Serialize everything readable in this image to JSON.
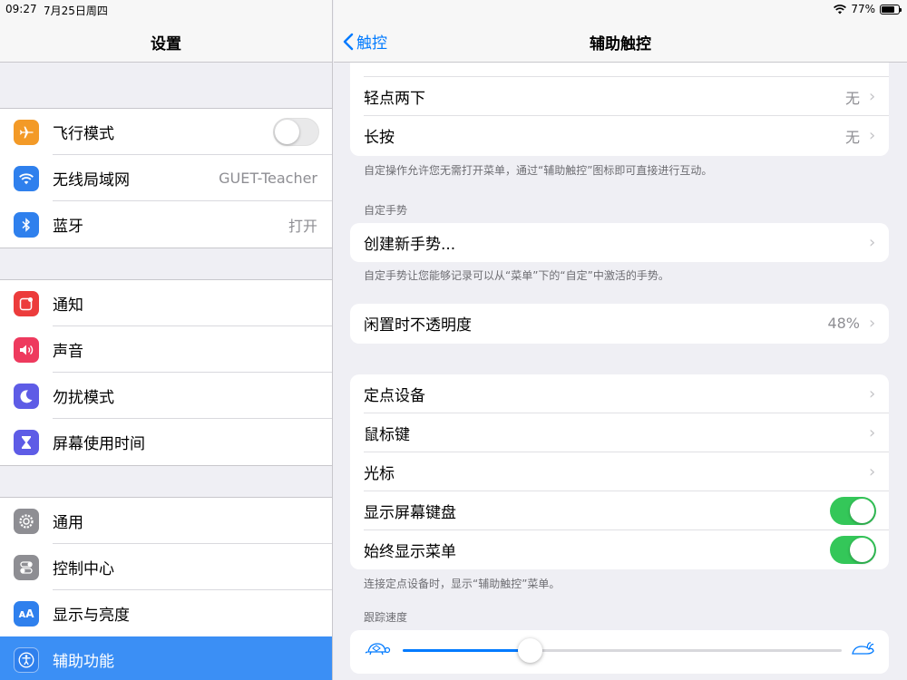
{
  "status": {
    "time": "09:27",
    "date": "7月25日周四",
    "battery": "77%"
  },
  "sidebar": {
    "title": "设置",
    "groups": [
      [
        {
          "label": "飞行模式",
          "icon": "airplane-icon",
          "color": "#f39a27",
          "toggle": "off"
        },
        {
          "label": "无线局域网",
          "icon": "wifi-icon",
          "color": "#2f80ed",
          "value": "GUET-Teacher"
        },
        {
          "label": "蓝牙",
          "icon": "bluetooth-icon",
          "color": "#2f80ed",
          "value": "打开"
        }
      ],
      [
        {
          "label": "通知",
          "icon": "notifications-icon",
          "color": "#ec3c3c"
        },
        {
          "label": "声音",
          "icon": "sound-icon",
          "color": "#ee3a5e"
        },
        {
          "label": "勿扰模式",
          "icon": "moon-icon",
          "color": "#5e5ce6"
        },
        {
          "label": "屏幕使用时间",
          "icon": "hourglass-icon",
          "color": "#5e5ce6"
        }
      ],
      [
        {
          "label": "通用",
          "icon": "gear-icon",
          "color": "#8e8e93"
        },
        {
          "label": "控制中心",
          "icon": "control-center-icon",
          "color": "#8e8e93"
        },
        {
          "label": "显示与亮度",
          "icon": "display-brightness-icon",
          "color": "#2f80ed"
        },
        {
          "label": "辅助功能",
          "icon": "accessibility-icon",
          "color": "#2f80ed",
          "selected": true
        }
      ]
    ]
  },
  "main": {
    "back_label": "触控",
    "title": "辅助触控",
    "card1": [
      {
        "label": "轻点两下",
        "value": "无"
      },
      {
        "label": "长按",
        "value": "无"
      }
    ],
    "card1_footer": "自定操作允许您无需打开菜单，通过“辅助触控”图标即可直接进行互动。",
    "custom_header": "自定手势",
    "create_gesture": "创建新手势...",
    "custom_footer": "自定手势让您能够记录可以从“菜单”下的“自定”中激活的手势。",
    "opacity_label": "闲置时不透明度",
    "opacity_value": "48%",
    "card4": [
      {
        "label": "定点设备",
        "type": "chevron"
      },
      {
        "label": "鼠标键",
        "type": "chevron"
      },
      {
        "label": "光标",
        "type": "chevron"
      },
      {
        "label": "显示屏幕键盘",
        "type": "toggle",
        "state": "on"
      },
      {
        "label": "始终显示菜单",
        "type": "toggle",
        "state": "on"
      }
    ],
    "card4_footer": "连接定点设备时，显示“辅助触控”菜单。",
    "tracking_header": "跟踪速度",
    "tracking_speed": 0.29
  }
}
